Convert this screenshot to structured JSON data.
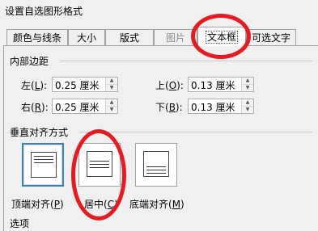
{
  "window": {
    "title": "设置自选图形格式"
  },
  "tabs": [
    {
      "label": "颜色与线条",
      "state": "normal"
    },
    {
      "label": "大小",
      "state": "normal"
    },
    {
      "label": "版式",
      "state": "normal"
    },
    {
      "label": "图片",
      "state": "disabled"
    },
    {
      "label": "文本框",
      "state": "active"
    },
    {
      "label": "可选文字",
      "state": "normal"
    }
  ],
  "margins": {
    "title": "内部边距",
    "left": {
      "label_prefix": "左(",
      "key": "L",
      "label_suffix": "):",
      "value": "0.25 厘米"
    },
    "right": {
      "label_prefix": "右(",
      "key": "R",
      "label_suffix": "):",
      "value": "0.25 厘米"
    },
    "top": {
      "label_prefix": "上(",
      "key": "O",
      "label_suffix": "):",
      "value": "0.13 厘米"
    },
    "bottom": {
      "label_prefix": "下(",
      "key": "B",
      "label_suffix": "):",
      "value": "0.13 厘米"
    }
  },
  "vertical_alignment": {
    "title": "垂直对齐方式",
    "options": [
      {
        "label_prefix": "顶端对齐(",
        "key": "P",
        "label_suffix": ")",
        "selected": true
      },
      {
        "label_prefix": "居中(",
        "key": "C",
        "label_suffix": ")",
        "selected": false
      },
      {
        "label_prefix": "底端对齐(",
        "key": "M",
        "label_suffix": ")",
        "selected": false
      }
    ]
  },
  "options_section": {
    "title": "选项"
  },
  "annotation_color": "#e8191f",
  "selection_color": "#3c7fb1"
}
